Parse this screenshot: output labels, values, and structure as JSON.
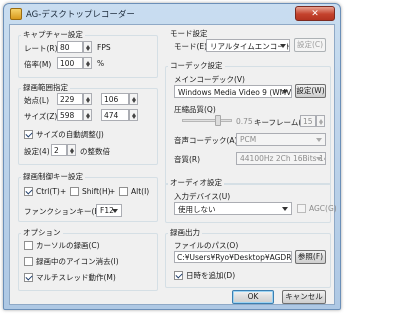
{
  "window": {
    "title": "AG-デスクトップレコーダー",
    "close_label": "✕"
  },
  "capture": {
    "legend": "キャプチャー設定",
    "rate_label": "レート(R)",
    "rate_value": "80",
    "rate_unit": "FPS",
    "scale_label": "倍率(M)",
    "scale_value": "100",
    "scale_unit": "%"
  },
  "area": {
    "legend": "録画範囲指定",
    "origin_label": "始点(L)",
    "origin_x": "229",
    "origin_y": "106",
    "size_label": "サイズ(Z)",
    "size_w": "598",
    "size_h": "474",
    "auto_adjust_label": "サイズの自動調整(J)",
    "auto_adjust_checked": true,
    "setting_label": "設定(4)",
    "setting_value": "2",
    "setting_suffix": "の整数倍"
  },
  "hotkey": {
    "legend": "録画制御キー設定",
    "ctrl_label": "Ctrl(T)",
    "ctrl_checked": true,
    "plus": "+",
    "shift_label": "Shift(H)",
    "shift_checked": false,
    "alt_label": "Alt(I)",
    "alt_checked": false,
    "fkey_label": "ファンクションキー(E)",
    "fkey_value": "F12"
  },
  "options": {
    "legend": "オプション",
    "cursor_label": "カーソルの録画(C)",
    "cursor_checked": false,
    "icon_label": "録画中のアイコン消去(I)",
    "icon_checked": false,
    "multithread_label": "マルチスレッド動作(M)",
    "multithread_checked": true
  },
  "mode": {
    "legend": "モード設定",
    "mode_label": "モード(E)",
    "mode_value": "リアルタイムエンコード",
    "setting_button": "設定(C)"
  },
  "codec": {
    "legend": "コーデック設定",
    "main_label": "メインコーデック(V)",
    "main_value": "Windows Media Video 9 (WMV形式)",
    "setting_button": "設定(W)",
    "quality_label": "圧縮品質(Q)",
    "quality_value": "0.75",
    "keyframe_label": "キーフレーム(Y)",
    "keyframe_value": "15",
    "audio_codec_label": "音声コーデック(A)",
    "audio_codec_value": "PCM",
    "audio_quality_label": "音質(R)",
    "audio_quality_value": "44100Hz 2Ch 16Bits 1411kbps"
  },
  "audio": {
    "legend": "オーディオ設定",
    "input_label": "入力デバイス(U)",
    "input_value": "使用しない",
    "agc_label": "AGC(G)",
    "agc_checked": false
  },
  "output": {
    "legend": "録画出力",
    "path_label": "ファイルのパス(O)",
    "path_value": "C:¥Users¥Ryo¥Desktop¥AGDRec.wmv",
    "browse_button": "参照(F)",
    "date_label": "日時を追加(D)",
    "date_checked": true
  },
  "buttons": {
    "ok": "OK",
    "cancel": "キャンセル"
  }
}
